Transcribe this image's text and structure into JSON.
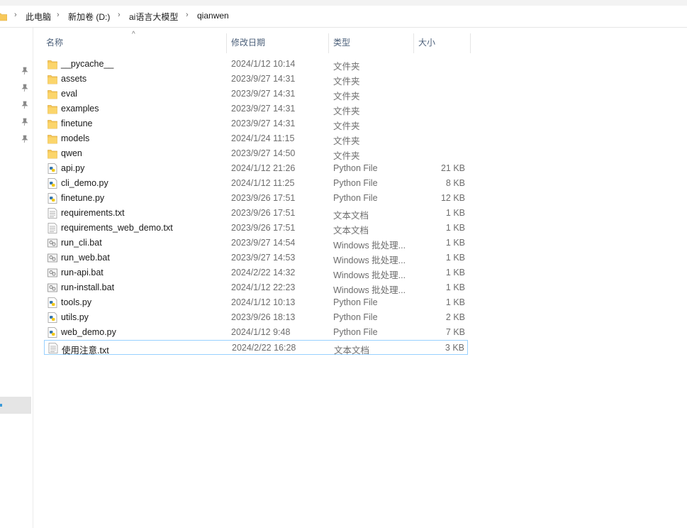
{
  "breadcrumb": {
    "items": [
      "此电脑",
      "新加卷 (D:)",
      "ai语言大模型",
      "qianwen"
    ],
    "separator": "›"
  },
  "columns": {
    "name": "名称",
    "date": "修改日期",
    "type": "类型",
    "size": "大小"
  },
  "files": [
    {
      "name": "__pycache__",
      "date": "2024/1/12 10:14",
      "type": "文件夹",
      "size": "",
      "icon": "folder-icon"
    },
    {
      "name": "assets",
      "date": "2023/9/27 14:31",
      "type": "文件夹",
      "size": "",
      "icon": "folder-icon"
    },
    {
      "name": "eval",
      "date": "2023/9/27 14:31",
      "type": "文件夹",
      "size": "",
      "icon": "folder-icon"
    },
    {
      "name": "examples",
      "date": "2023/9/27 14:31",
      "type": "文件夹",
      "size": "",
      "icon": "folder-icon"
    },
    {
      "name": "finetune",
      "date": "2023/9/27 14:31",
      "type": "文件夹",
      "size": "",
      "icon": "folder-icon"
    },
    {
      "name": "models",
      "date": "2024/1/24 11:15",
      "type": "文件夹",
      "size": "",
      "icon": "folder-icon"
    },
    {
      "name": "qwen",
      "date": "2023/9/27 14:50",
      "type": "文件夹",
      "size": "",
      "icon": "folder-icon"
    },
    {
      "name": "api.py",
      "date": "2024/1/12 21:26",
      "type": "Python File",
      "size": "21 KB",
      "icon": "python-file-icon"
    },
    {
      "name": "cli_demo.py",
      "date": "2024/1/12 11:25",
      "type": "Python File",
      "size": "8 KB",
      "icon": "python-file-icon"
    },
    {
      "name": "finetune.py",
      "date": "2023/9/26 17:51",
      "type": "Python File",
      "size": "12 KB",
      "icon": "python-file-icon"
    },
    {
      "name": "requirements.txt",
      "date": "2023/9/26 17:51",
      "type": "文本文档",
      "size": "1 KB",
      "icon": "text-file-icon"
    },
    {
      "name": "requirements_web_demo.txt",
      "date": "2023/9/26 17:51",
      "type": "文本文档",
      "size": "1 KB",
      "icon": "text-file-icon"
    },
    {
      "name": "run_cli.bat",
      "date": "2023/9/27 14:54",
      "type": "Windows 批处理...",
      "size": "1 KB",
      "icon": "batch-file-icon"
    },
    {
      "name": "run_web.bat",
      "date": "2023/9/27 14:53",
      "type": "Windows 批处理...",
      "size": "1 KB",
      "icon": "batch-file-icon"
    },
    {
      "name": "run-api.bat",
      "date": "2024/2/22 14:32",
      "type": "Windows 批处理...",
      "size": "1 KB",
      "icon": "batch-file-icon"
    },
    {
      "name": "run-install.bat",
      "date": "2024/1/12 22:23",
      "type": "Windows 批处理...",
      "size": "1 KB",
      "icon": "batch-file-icon"
    },
    {
      "name": "tools.py",
      "date": "2024/1/12 10:13",
      "type": "Python File",
      "size": "1 KB",
      "icon": "python-file-icon"
    },
    {
      "name": "utils.py",
      "date": "2023/9/26 18:13",
      "type": "Python File",
      "size": "2 KB",
      "icon": "python-file-icon"
    },
    {
      "name": "web_demo.py",
      "date": "2024/1/12 9:48",
      "type": "Python File",
      "size": "7 KB",
      "icon": "python-file-icon"
    },
    {
      "name": "使用注意.txt",
      "date": "2024/2/22 16:28",
      "type": "文本文档",
      "size": "3 KB",
      "icon": "text-file-icon",
      "selected": true
    }
  ],
  "colors": {
    "folder": "#f7c85a",
    "selection_border": "#99d1ff",
    "header_text": "#4c607a"
  }
}
